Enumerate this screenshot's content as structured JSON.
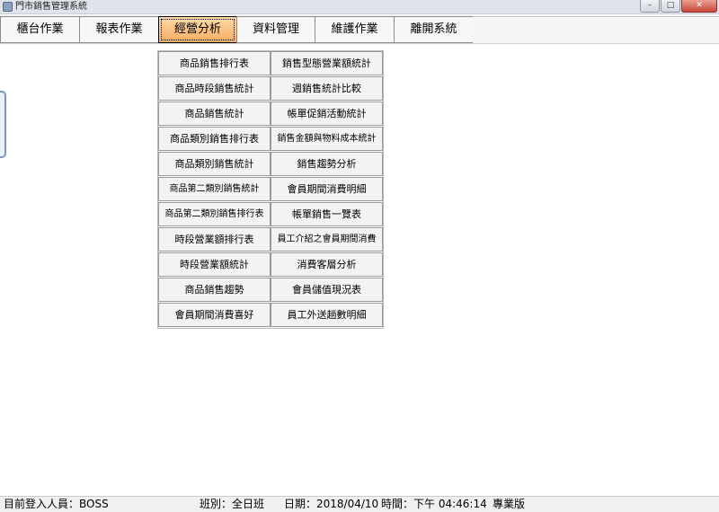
{
  "window": {
    "title": "門市銷售管理系統",
    "controls": {
      "minimize": "–",
      "maximize": "□",
      "close": "✕"
    }
  },
  "menu": {
    "items": [
      {
        "label": "櫃台作業"
      },
      {
        "label": "報表作業"
      },
      {
        "label": "經營分析"
      },
      {
        "label": "資料管理"
      },
      {
        "label": "維護作業"
      },
      {
        "label": "離開系統"
      }
    ],
    "active": "經營分析"
  },
  "dropdown": {
    "left": [
      "商品銷售排行表",
      "商品時段銷售統計",
      "商品銷售統計",
      "商品類別銷售排行表",
      "商品類別銷售統計",
      "商品第二類別銷售統計",
      "商品第二類別銷售排行表",
      "時段營業額排行表",
      "時段營業額統計",
      "商品銷售趨勢",
      "會員期間消費喜好"
    ],
    "right": [
      "銷售型態營業額統計",
      "週銷售統計比較",
      "帳單促銷活動統計",
      "銷售金額與物料成本統計",
      "銷售趨勢分析",
      "會員期間消費明細",
      "帳單銷售一覽表",
      "員工介紹之會員期間消費",
      "消費客層分析",
      "會員儲值現況表",
      "員工外送趟數明細"
    ]
  },
  "status": {
    "user": "目前登入人員：BOSS",
    "shift": "班別：全日班",
    "date": "日期：2018/04/10",
    "time": "時間：下午 04:46:14",
    "edition": "專業版"
  }
}
